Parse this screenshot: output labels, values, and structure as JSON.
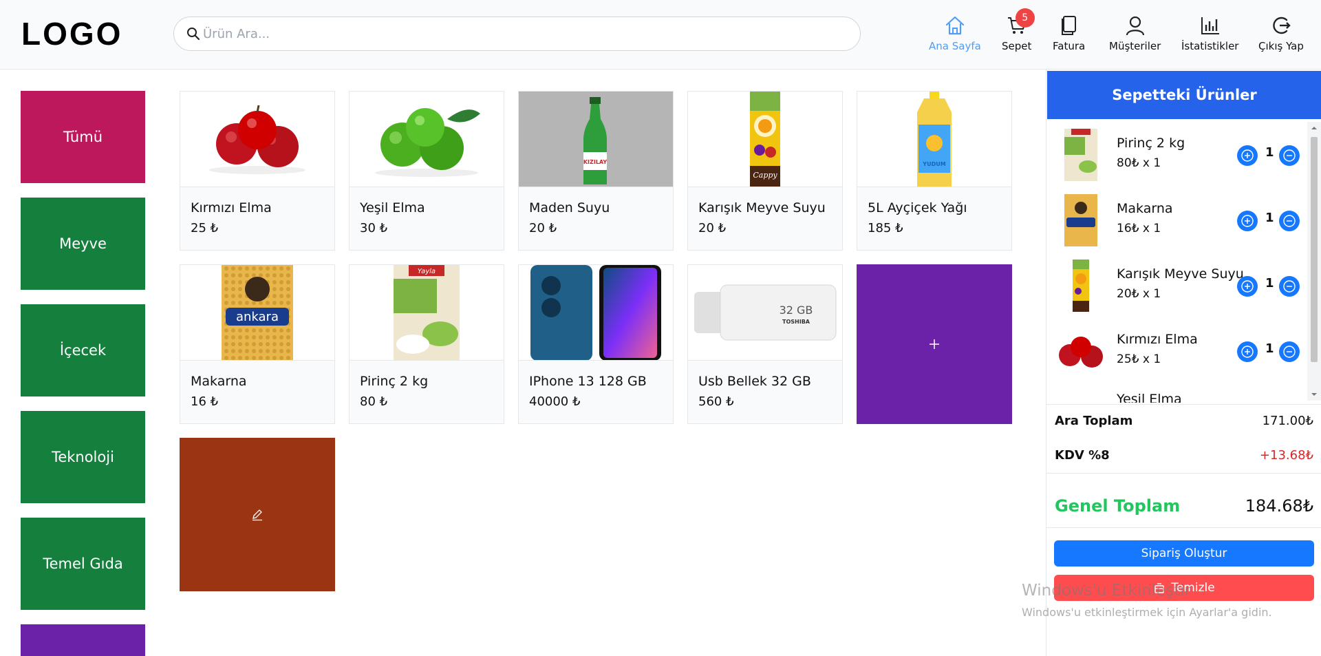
{
  "header": {
    "logo": "LOGO",
    "search_placeholder": "Ürün Ara...",
    "nav": [
      {
        "label": "Ana Sayfa",
        "icon": "home-icon",
        "active": true
      },
      {
        "label": "Sepet",
        "icon": "cart-icon",
        "badge": "5"
      },
      {
        "label": "Fatura",
        "icon": "invoice-icon"
      },
      {
        "label": "Müşteriler",
        "icon": "user-icon"
      },
      {
        "label": "İstatistikler",
        "icon": "chart-icon"
      },
      {
        "label": "Çıkış Yap",
        "icon": "logout-icon"
      }
    ]
  },
  "categories": [
    {
      "label": "Tümü",
      "color": "#be185d"
    },
    {
      "label": "Meyve",
      "color": "#15803d"
    },
    {
      "label": "İçecek",
      "color": "#15803d"
    },
    {
      "label": "Teknoloji",
      "color": "#15803d"
    },
    {
      "label": "Temel Gıda",
      "color": "#15803d"
    },
    {
      "label": "",
      "color": "#6b21a8"
    }
  ],
  "products": [
    {
      "name": "Kırmızı Elma",
      "price": "25 ₺"
    },
    {
      "name": "Yeşil Elma",
      "price": "30 ₺"
    },
    {
      "name": "Maden Suyu",
      "price": "20 ₺"
    },
    {
      "name": "Karışık Meyve Suyu",
      "price": "20 ₺"
    },
    {
      "name": "5L Ayçiçek Yağı",
      "price": "185 ₺"
    },
    {
      "name": "Makarna",
      "price": "16 ₺"
    },
    {
      "name": "Pirinç 2 kg",
      "price": "80 ₺"
    },
    {
      "name": "IPhone 13 128 GB",
      "price": "40000 ₺"
    },
    {
      "name": "Usb Bellek 32 GB",
      "price": "560 ₺"
    }
  ],
  "product_image_labels": {
    "water": "KIZILAY",
    "juice": "Cappy",
    "oil": "YUDUM",
    "pasta": "ankara",
    "rice": "Yayla",
    "usb_size": "32 GB",
    "usb_brand": "TOSHIBA"
  },
  "tiles": {
    "add_icon": "plus-icon",
    "add_color": "#6b21a8",
    "edit_icon": "pencil-icon",
    "edit_color": "#9a3412"
  },
  "cart": {
    "title": "Sepetteki Ürünler",
    "items": [
      {
        "name": "Pirinç 2 kg",
        "price": "80₺ x 1",
        "qty": "1"
      },
      {
        "name": "Makarna",
        "price": "16₺ x 1",
        "qty": "1"
      },
      {
        "name": "Karışık Meyve Suyu",
        "price": "20₺ x 1",
        "qty": "1"
      },
      {
        "name": "Kırmızı Elma",
        "price": "25₺ x 1",
        "qty": "1"
      },
      {
        "name": "Yeşil Elma",
        "price": "",
        "qty": ""
      }
    ],
    "subtotal_label": "Ara Toplam",
    "subtotal": "171.00₺",
    "tax_label": "KDV %8",
    "tax": "+13.68₺",
    "total_label": "Genel Toplam",
    "total": "184.68₺",
    "order_button": "Sipariş Oluştur",
    "clear_button": "Temizle"
  },
  "watermark": {
    "line1": "Windows'u Etkinleştir",
    "line2": "Windows'u etkinleştirmek için Ayarlar'a gidin."
  },
  "colors": {
    "accent": "#2563eb",
    "nav_active": "#4f9df5",
    "badge": "#ef4444",
    "total_green": "#22c55e",
    "tax_red": "#dc2626",
    "clear_red": "#ff4d4f",
    "order_blue": "#1677ff"
  }
}
